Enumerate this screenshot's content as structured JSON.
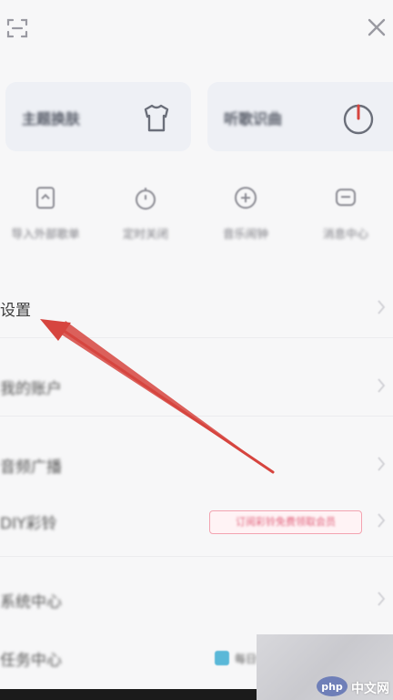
{
  "colors": {
    "background": "#f7f7f8",
    "card": "#eef0f5",
    "arrow": "#d6453f",
    "promo_border": "#f3a3b0",
    "promo_text": "#e0607a",
    "square_icon": "#5ab8d8",
    "watermark_logo": "#6f7fb8"
  },
  "topbar": {
    "left_icon": "scan-icon",
    "right_icon": "close-icon"
  },
  "cards": [
    {
      "label": "主题换肤",
      "icon": "tshirt-icon"
    },
    {
      "label": "听歌识曲",
      "icon": "music-recognition-icon"
    }
  ],
  "quick_actions": [
    {
      "label": "导入外部歌单",
      "icon": "import-playlist-icon"
    },
    {
      "label": "定时关闭",
      "icon": "timer-icon"
    },
    {
      "label": "音乐闹钟",
      "icon": "alarm-icon"
    },
    {
      "label": "消息中心",
      "icon": "message-icon"
    }
  ],
  "menu": [
    {
      "label": "设置"
    },
    {
      "label": "我的账户"
    },
    {
      "label": "音频广播"
    },
    {
      "label": "DIY彩铃",
      "badge": "订阅彩铃免费领取会员"
    },
    {
      "label": "系统中心"
    },
    {
      "label": "任务中心",
      "badge": "每日任务"
    }
  ],
  "watermark": {
    "logo_text": "php",
    "text": "中文网"
  }
}
